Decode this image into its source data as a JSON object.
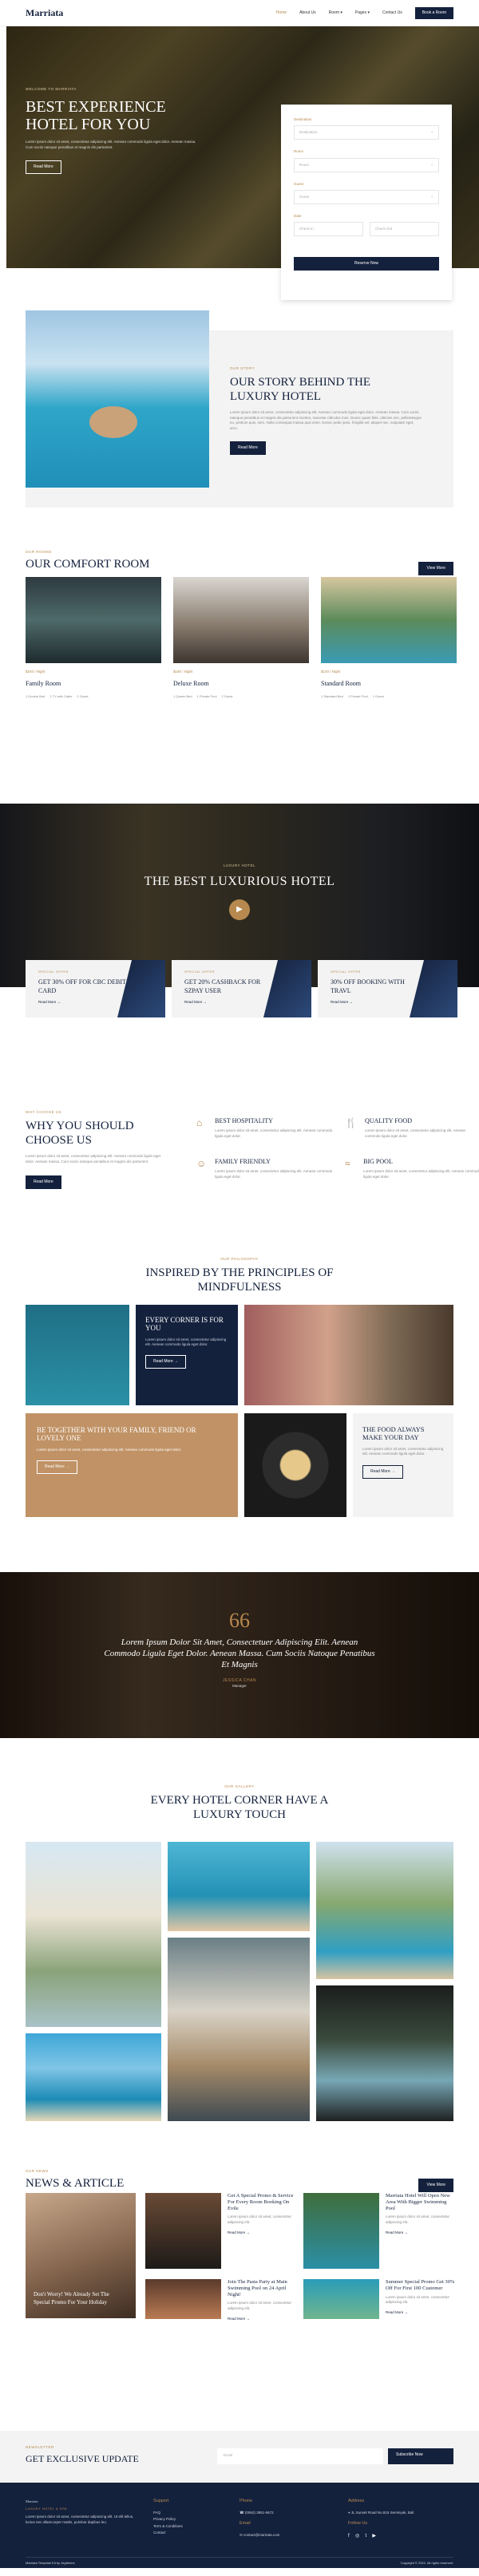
{
  "header": {
    "logo": "Marriata",
    "nav": [
      "Home",
      "About Us",
      "Room ▾",
      "Pages ▾",
      "Contact Us"
    ],
    "book_label": "Book a Room"
  },
  "hero": {
    "eyebrow": "Welcome to Marriata",
    "title": "Best Experience Hotel For You",
    "text": "Lorem ipsum dolor sit amet, consectetur adipiscing elit. Aenean commodo ligula eget dolor. Aenean massa. Cum sociis natoque penatibus et magnis dis parturient.",
    "button": "Read More",
    "booking": {
      "destination_label": "Destination",
      "destination_placeholder": "Destination",
      "room_label": "Room",
      "room_placeholder": "Room",
      "guest_label": "Guest",
      "guest_placeholder": "Guest",
      "date_label": "Date",
      "checkin_placeholder": "Check In",
      "checkout_placeholder": "Check Out",
      "button": "Reserve Now"
    }
  },
  "story": {
    "eyebrow": "Our Story",
    "title": "Our Story Behind The Luxury Hotel",
    "text": "Lorem ipsum dolor sit amet, consectetur adipiscing elit. Aenean commodo ligula eget dolor. Aenean massa. Cum sociis natoque penatibus et magnis dis parturient montes, nascetur ridiculus mus. Donec quam felis, ultricies nec, pellentesque eu, pretium quis, sem. Nulla consequat massa quis enim. Donec pede justo, fringilla vel, aliquet nec, vulputate eget, arcu.",
    "button": "Read More"
  },
  "comfort": {
    "eyebrow": "Our Rooms",
    "title": "Our Comfort Room",
    "view_more": "View More",
    "rooms": [
      {
        "price": "$240 / Night",
        "name": "Family Room",
        "amenities": [
          "1 Double Bed",
          "1 TV with Cable",
          "2 Guest"
        ]
      },
      {
        "price": "$180 / Night",
        "name": "Deluxe Room",
        "amenities": [
          "1 Queen Bed",
          "1 Private Pool",
          "2 Guest"
        ]
      },
      {
        "price": "$140 / Night",
        "name": "Standard Room",
        "amenities": [
          "1 Standard Bed",
          "1 Private Pool",
          "1 Guest"
        ]
      }
    ]
  },
  "luxury": {
    "eyebrow": "Luxury Hotel",
    "title": "The Best Luxurious Hotel",
    "offers": [
      {
        "eyebrow": "Special Offer",
        "title": "Get 30% Off For CBC Debit Card",
        "link": "Read More →"
      },
      {
        "eyebrow": "Special Offer",
        "title": "Get 20% Cashback For SZPAY User",
        "link": "Read More →"
      },
      {
        "eyebrow": "Special Offer",
        "title": "30% Off Booking With Travl",
        "link": "Read More →"
      }
    ]
  },
  "why": {
    "eyebrow": "Why Choose Us",
    "title": "Why You Should Choose Us",
    "text": "Lorem ipsum dolor sit amet, consectetur adipiscing elit. Aenean commodo ligula eget dolor. Aenean massa. Cum sociis natoque penatibus et magnis dis parturient.",
    "button": "Read More",
    "features": [
      {
        "icon": "building-icon",
        "title": "Best Hospitality",
        "text": "Lorem ipsum dolor sit amet, consectetur adipiscing elit. Aenean commodo ligula eget dolor."
      },
      {
        "icon": "food-icon",
        "title": "Quality Food",
        "text": "Lorem ipsum dolor sit amet, consectetur adipiscing elit. Aenean commodo ligula eget dolor."
      },
      {
        "icon": "family-icon",
        "title": "Family Friendly",
        "text": "Lorem ipsum dolor sit amet, consectetur adipiscing elit. Aenean commodo ligula eget dolor."
      },
      {
        "icon": "pool-icon",
        "title": "Big Pool",
        "text": "Lorem ipsum dolor sit amet, consectetur adipiscing elit. Aenean commodo ligula eget dolor."
      }
    ]
  },
  "inspired": {
    "eyebrow": "Our Philosophy",
    "title": "Inspired By The Principles Of Mindfulness",
    "card1_title": "Every Corner Is For You",
    "card1_text": "Lorem ipsum dolor sit amet, consectetur adipiscing elit. Aenean commodo ligula eget dolor.",
    "card1_button": "Read More →",
    "card2_title": "Be Together With Your Family, Friend Or Lovely One",
    "card2_text": "Lorem ipsum dolor sit amet, consectetur adipiscing elit. Aenean commodo ligula eget dolor.",
    "card2_button": "Read More →",
    "card3_title": "The Food Always Make Your Day",
    "card3_text": "Lorem ipsum dolor sit amet, consectetur adipiscing elit. Aenean commodo ligula eget dolor.",
    "card3_button": "Read More →"
  },
  "quote": {
    "mark": "66",
    "text": "Lorem Ipsum Dolor Sit Amet, Consectetuer Adipiscing Elit. Aenean Commodo Ligula Eget Dolor. Aenean Massa. Cum Sociis Natoque Penatibus Et Magnis",
    "name": "Jessica Chan",
    "role": "Manager"
  },
  "gallery": {
    "eyebrow": "Our Gallery",
    "title": "Every Hotel Corner Have A Luxury Touch"
  },
  "news": {
    "eyebrow": "Our News",
    "title": "News & Article",
    "view_more": "View More",
    "featured": "Don't Worry! We Already Set The Special Promo For Your Holiday",
    "articles": [
      {
        "title": "Get A Special Promo & Service For Every Room Booking On Evile",
        "text": "Lorem ipsum dolor sit amet, consectetur adipiscing elit.",
        "link": "Read More →"
      },
      {
        "title": "Marriata Hotel Will Open New Area With Bigger Swimming Pool",
        "text": "Lorem ipsum dolor sit amet, consectetur adipiscing elit.",
        "link": "Read More →"
      },
      {
        "title": "Join The Pasta Party at Main Swimming Pool on 24 April Night!",
        "text": "Lorem ipsum dolor sit amet, consectetur adipiscing elit.",
        "link": "Read More →"
      },
      {
        "title": "Summer Special Promo Get 30% Off For First 100 Customer",
        "text": "Lorem ipsum dolor sit amet, consectetur adipiscing elit.",
        "link": "Read More →"
      }
    ]
  },
  "newsletter": {
    "eyebrow": "Newsletter",
    "title": "Get Exclusive Update",
    "placeholder": "Email",
    "button": "Subscribe Now"
  },
  "footer": {
    "logo": "Marriata",
    "tagline": "Luxury Hotel & Spa",
    "about": "Lorem ipsum dolor sit amet, consectetur adipiscing elit. Ut elit tellus, luctus nec ullamcorper mattis, pulvinar dapibus leo.",
    "support_title": "Support",
    "support_links": [
      "FAQ",
      "Privacy Policy",
      "Term & Conditions",
      "Contact"
    ],
    "phone_title": "Phone",
    "phone": "(0062) 3851-5672",
    "email_title": "Email",
    "email": "contact@marriata.com",
    "address_title": "Address",
    "address": "JL Sunset Road No.815 Seminyak, Bali",
    "follow_title": "Follow Us",
    "credit": "Marriata Template Kit by Jegtheme",
    "copyright": "Copyright © 2022. All rights reserved."
  },
  "colors": {
    "navy": "#14213d",
    "gold": "#b7894f",
    "light": "#f3f3f3"
  }
}
